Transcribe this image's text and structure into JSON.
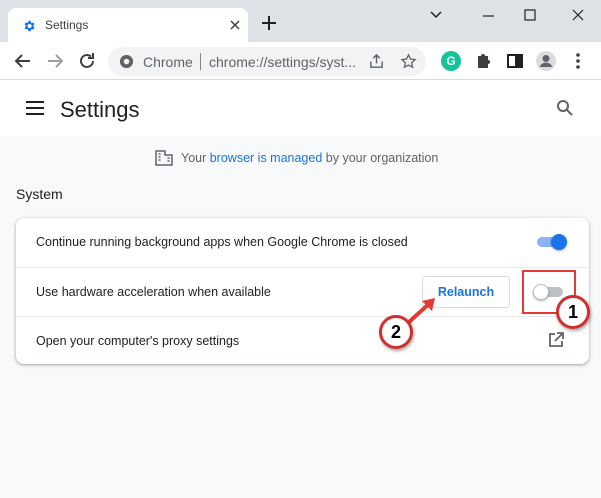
{
  "browser": {
    "tab_title": "Settings",
    "omnibox_site": "Chrome",
    "omnibox_url": "chrome://settings/syst...",
    "extension_letter": "G"
  },
  "settings": {
    "title": "Settings",
    "managed": {
      "prefix": "Your ",
      "link": "browser is managed",
      "suffix": " by your organization"
    },
    "section": "System",
    "rows": [
      {
        "label": "Continue running background apps when Google Chrome is closed",
        "toggle_on": true
      },
      {
        "label": "Use hardware acceleration when available",
        "toggle_on": false,
        "button": "Relaunch"
      },
      {
        "label": "Open your computer's proxy settings"
      }
    ]
  },
  "annotations": {
    "step1": "1",
    "step2": "2"
  },
  "colors": {
    "accent": "#1a73e8",
    "annotation": "#e53935"
  }
}
